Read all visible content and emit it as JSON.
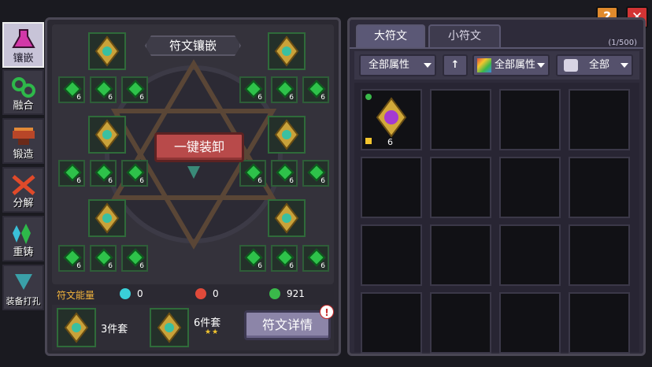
{
  "sidenav": {
    "items": [
      {
        "label": "镶嵌",
        "icon": "flask-icon"
      },
      {
        "label": "融合",
        "icon": "chain-icon"
      },
      {
        "label": "锻造",
        "icon": "anvil-icon"
      },
      {
        "label": "分解",
        "icon": "hammer-icon"
      },
      {
        "label": "重铸",
        "icon": "crystal-icon"
      },
      {
        "label": "装备打孔",
        "icon": "drill-icon"
      }
    ]
  },
  "left_panel": {
    "title": "符文镶嵌",
    "unequip_label": "一键装卸",
    "small_rune_level": "6",
    "energy": {
      "label": "符文能量",
      "blue": "0",
      "red": "0",
      "green": "921"
    },
    "sets": [
      {
        "label": "3件套"
      },
      {
        "label": "6件套",
        "stars": "★★"
      }
    ],
    "detail_label": "符文详情",
    "notif": "!"
  },
  "right_panel": {
    "tabs": [
      "大符文",
      "小符文"
    ],
    "count": "(1/500)",
    "filters": {
      "attr1": "全部属性",
      "sort_icon": "↑",
      "attr2": "全部属性",
      "type": "全部"
    },
    "first_item_level": "6"
  },
  "top_buttons": {
    "help": "?",
    "close": "✕"
  }
}
